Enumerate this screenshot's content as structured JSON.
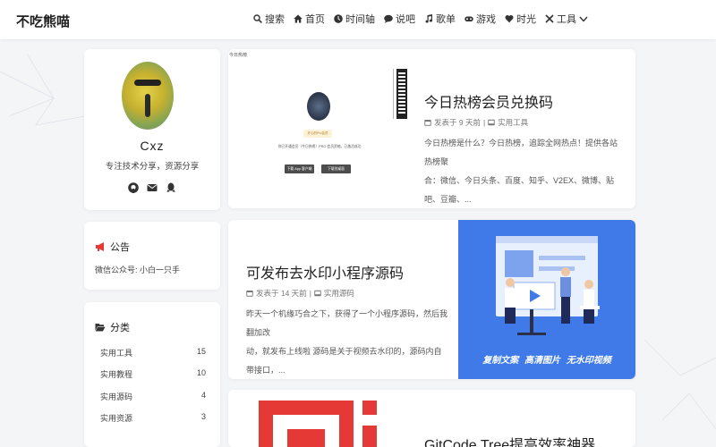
{
  "site": {
    "logo": "不吃熊喵"
  },
  "nav": {
    "items": [
      {
        "label": "搜索",
        "icon": "search-icon"
      },
      {
        "label": "首页",
        "icon": "home-icon"
      },
      {
        "label": "时间轴",
        "icon": "clock-icon"
      },
      {
        "label": "说吧",
        "icon": "chat-icon"
      },
      {
        "label": "歌单",
        "icon": "music-icon"
      },
      {
        "label": "游戏",
        "icon": "gamepad-icon"
      },
      {
        "label": "时光",
        "icon": "heart-icon"
      },
      {
        "label": "工具",
        "icon": "tools-icon"
      }
    ]
  },
  "profile": {
    "name": "Cxz",
    "bio": "专注技术分享，资源分享"
  },
  "notice": {
    "title": "公告",
    "text": "微信公众号: 小白一只手"
  },
  "category": {
    "title": "分类",
    "items": [
      {
        "name": "实用工具",
        "count": "15"
      },
      {
        "name": "实用教程",
        "count": "10"
      },
      {
        "name": "实用源码",
        "count": "4"
      },
      {
        "name": "实用资源",
        "count": "3"
      }
    ]
  },
  "posts": [
    {
      "title": "今日热榜会员兑换码",
      "time": "发表于 9 天前",
      "category": "实用工具",
      "excerpt1": "今日热榜是什么？今日热榜，追踪全网热点！提供各站热榜聚",
      "excerpt2": "合：微信、今日头条、百度、知乎、V2EX、微博、贴吧、豆瓣、...",
      "thumb": {
        "label": "今日热榜",
        "badge": "开心的Pro会员",
        "text": "你已开通会员（今日热榜）PRO 会员资格，已激活成功",
        "button1": "下载 App 客户端",
        "button2": "下载到桌面"
      }
    },
    {
      "title": "可发布去水印小程序源码",
      "time": "发表于 14 天前",
      "category": "实用源码",
      "excerpt1": "昨天一个机缘巧合之下，获得了一个小程序源码，然后我翻加改",
      "excerpt2": "动，就发布上线啦 源码是关于视频去水印的，源码内自带接口，...",
      "thumb": {
        "caption": "复制文案 高清图片 无水印视频"
      }
    },
    {
      "title": "GitCode Tree提高效率神器"
    }
  ],
  "colors": {
    "accent_red": "#e53935",
    "banner_blue": "#3f7ae8"
  }
}
